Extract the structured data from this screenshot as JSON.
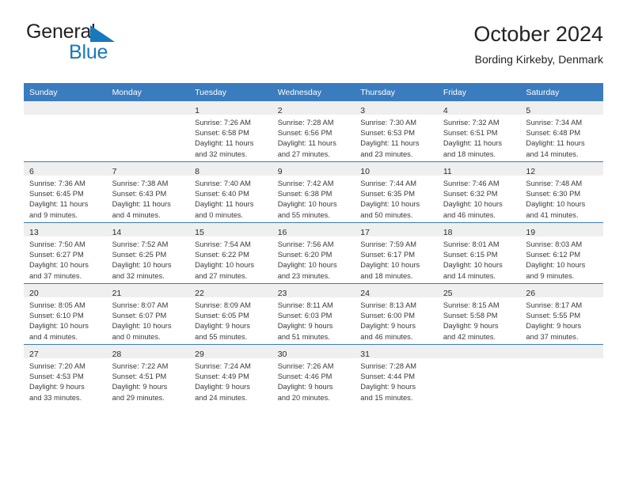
{
  "brand": {
    "name_top": "General",
    "name_bottom": "Blue",
    "color_dark": "#231f20",
    "color_blue": "#1878be"
  },
  "header": {
    "title": "October 2024",
    "subtitle": "Bording Kirkeby, Denmark"
  },
  "theme": {
    "header_blue": "#3a7cbe",
    "band_gray": "#efefef",
    "text": "#3a3a3a"
  },
  "weekday_headers": [
    "Sunday",
    "Monday",
    "Tuesday",
    "Wednesday",
    "Thursday",
    "Friday",
    "Saturday"
  ],
  "weeks": [
    [
      {
        "day": "",
        "sunrise": "",
        "sunset": "",
        "daylight": "",
        "daylight2": ""
      },
      {
        "day": "",
        "sunrise": "",
        "sunset": "",
        "daylight": "",
        "daylight2": ""
      },
      {
        "day": "1",
        "sunrise": "Sunrise: 7:26 AM",
        "sunset": "Sunset: 6:58 PM",
        "daylight": "Daylight: 11 hours",
        "daylight2": "and 32 minutes."
      },
      {
        "day": "2",
        "sunrise": "Sunrise: 7:28 AM",
        "sunset": "Sunset: 6:56 PM",
        "daylight": "Daylight: 11 hours",
        "daylight2": "and 27 minutes."
      },
      {
        "day": "3",
        "sunrise": "Sunrise: 7:30 AM",
        "sunset": "Sunset: 6:53 PM",
        "daylight": "Daylight: 11 hours",
        "daylight2": "and 23 minutes."
      },
      {
        "day": "4",
        "sunrise": "Sunrise: 7:32 AM",
        "sunset": "Sunset: 6:51 PM",
        "daylight": "Daylight: 11 hours",
        "daylight2": "and 18 minutes."
      },
      {
        "day": "5",
        "sunrise": "Sunrise: 7:34 AM",
        "sunset": "Sunset: 6:48 PM",
        "daylight": "Daylight: 11 hours",
        "daylight2": "and 14 minutes."
      }
    ],
    [
      {
        "day": "6",
        "sunrise": "Sunrise: 7:36 AM",
        "sunset": "Sunset: 6:45 PM",
        "daylight": "Daylight: 11 hours",
        "daylight2": "and 9 minutes."
      },
      {
        "day": "7",
        "sunrise": "Sunrise: 7:38 AM",
        "sunset": "Sunset: 6:43 PM",
        "daylight": "Daylight: 11 hours",
        "daylight2": "and 4 minutes."
      },
      {
        "day": "8",
        "sunrise": "Sunrise: 7:40 AM",
        "sunset": "Sunset: 6:40 PM",
        "daylight": "Daylight: 11 hours",
        "daylight2": "and 0 minutes."
      },
      {
        "day": "9",
        "sunrise": "Sunrise: 7:42 AM",
        "sunset": "Sunset: 6:38 PM",
        "daylight": "Daylight: 10 hours",
        "daylight2": "and 55 minutes."
      },
      {
        "day": "10",
        "sunrise": "Sunrise: 7:44 AM",
        "sunset": "Sunset: 6:35 PM",
        "daylight": "Daylight: 10 hours",
        "daylight2": "and 50 minutes."
      },
      {
        "day": "11",
        "sunrise": "Sunrise: 7:46 AM",
        "sunset": "Sunset: 6:32 PM",
        "daylight": "Daylight: 10 hours",
        "daylight2": "and 46 minutes."
      },
      {
        "day": "12",
        "sunrise": "Sunrise: 7:48 AM",
        "sunset": "Sunset: 6:30 PM",
        "daylight": "Daylight: 10 hours",
        "daylight2": "and 41 minutes."
      }
    ],
    [
      {
        "day": "13",
        "sunrise": "Sunrise: 7:50 AM",
        "sunset": "Sunset: 6:27 PM",
        "daylight": "Daylight: 10 hours",
        "daylight2": "and 37 minutes."
      },
      {
        "day": "14",
        "sunrise": "Sunrise: 7:52 AM",
        "sunset": "Sunset: 6:25 PM",
        "daylight": "Daylight: 10 hours",
        "daylight2": "and 32 minutes."
      },
      {
        "day": "15",
        "sunrise": "Sunrise: 7:54 AM",
        "sunset": "Sunset: 6:22 PM",
        "daylight": "Daylight: 10 hours",
        "daylight2": "and 27 minutes."
      },
      {
        "day": "16",
        "sunrise": "Sunrise: 7:56 AM",
        "sunset": "Sunset: 6:20 PM",
        "daylight": "Daylight: 10 hours",
        "daylight2": "and 23 minutes."
      },
      {
        "day": "17",
        "sunrise": "Sunrise: 7:59 AM",
        "sunset": "Sunset: 6:17 PM",
        "daylight": "Daylight: 10 hours",
        "daylight2": "and 18 minutes."
      },
      {
        "day": "18",
        "sunrise": "Sunrise: 8:01 AM",
        "sunset": "Sunset: 6:15 PM",
        "daylight": "Daylight: 10 hours",
        "daylight2": "and 14 minutes."
      },
      {
        "day": "19",
        "sunrise": "Sunrise: 8:03 AM",
        "sunset": "Sunset: 6:12 PM",
        "daylight": "Daylight: 10 hours",
        "daylight2": "and 9 minutes."
      }
    ],
    [
      {
        "day": "20",
        "sunrise": "Sunrise: 8:05 AM",
        "sunset": "Sunset: 6:10 PM",
        "daylight": "Daylight: 10 hours",
        "daylight2": "and 4 minutes."
      },
      {
        "day": "21",
        "sunrise": "Sunrise: 8:07 AM",
        "sunset": "Sunset: 6:07 PM",
        "daylight": "Daylight: 10 hours",
        "daylight2": "and 0 minutes."
      },
      {
        "day": "22",
        "sunrise": "Sunrise: 8:09 AM",
        "sunset": "Sunset: 6:05 PM",
        "daylight": "Daylight: 9 hours",
        "daylight2": "and 55 minutes."
      },
      {
        "day": "23",
        "sunrise": "Sunrise: 8:11 AM",
        "sunset": "Sunset: 6:03 PM",
        "daylight": "Daylight: 9 hours",
        "daylight2": "and 51 minutes."
      },
      {
        "day": "24",
        "sunrise": "Sunrise: 8:13 AM",
        "sunset": "Sunset: 6:00 PM",
        "daylight": "Daylight: 9 hours",
        "daylight2": "and 46 minutes."
      },
      {
        "day": "25",
        "sunrise": "Sunrise: 8:15 AM",
        "sunset": "Sunset: 5:58 PM",
        "daylight": "Daylight: 9 hours",
        "daylight2": "and 42 minutes."
      },
      {
        "day": "26",
        "sunrise": "Sunrise: 8:17 AM",
        "sunset": "Sunset: 5:55 PM",
        "daylight": "Daylight: 9 hours",
        "daylight2": "and 37 minutes."
      }
    ],
    [
      {
        "day": "27",
        "sunrise": "Sunrise: 7:20 AM",
        "sunset": "Sunset: 4:53 PM",
        "daylight": "Daylight: 9 hours",
        "daylight2": "and 33 minutes."
      },
      {
        "day": "28",
        "sunrise": "Sunrise: 7:22 AM",
        "sunset": "Sunset: 4:51 PM",
        "daylight": "Daylight: 9 hours",
        "daylight2": "and 29 minutes."
      },
      {
        "day": "29",
        "sunrise": "Sunrise: 7:24 AM",
        "sunset": "Sunset: 4:49 PM",
        "daylight": "Daylight: 9 hours",
        "daylight2": "and 24 minutes."
      },
      {
        "day": "30",
        "sunrise": "Sunrise: 7:26 AM",
        "sunset": "Sunset: 4:46 PM",
        "daylight": "Daylight: 9 hours",
        "daylight2": "and 20 minutes."
      },
      {
        "day": "31",
        "sunrise": "Sunrise: 7:28 AM",
        "sunset": "Sunset: 4:44 PM",
        "daylight": "Daylight: 9 hours",
        "daylight2": "and 15 minutes."
      },
      {
        "day": "",
        "sunrise": "",
        "sunset": "",
        "daylight": "",
        "daylight2": ""
      },
      {
        "day": "",
        "sunrise": "",
        "sunset": "",
        "daylight": "",
        "daylight2": ""
      }
    ]
  ]
}
